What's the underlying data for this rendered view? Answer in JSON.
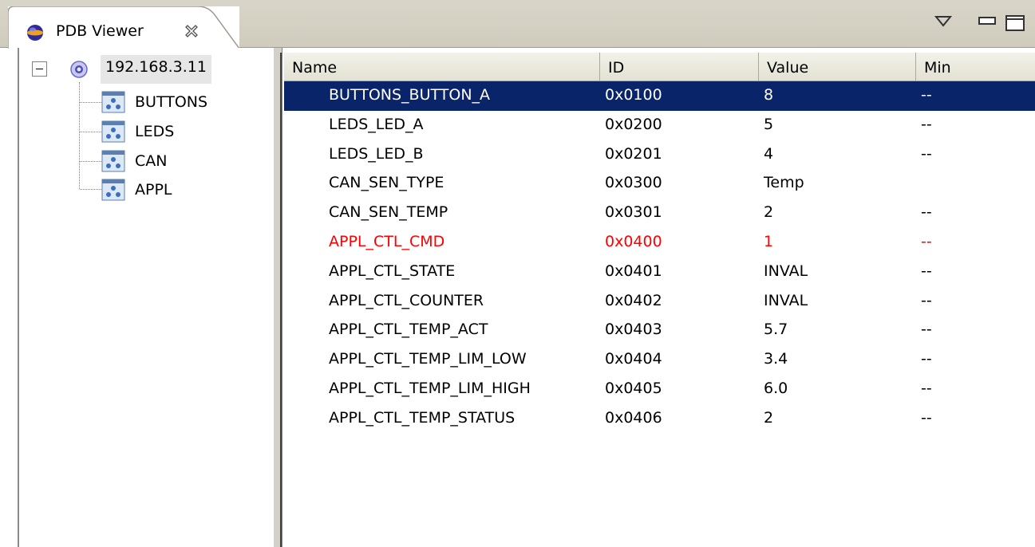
{
  "view_tab": {
    "title": "PDB Viewer",
    "icon": "globe-icon",
    "close_icon": "close-icon"
  },
  "view_toolbar": {
    "view_menu_icon": "view-menu-icon",
    "minimize_icon": "minimize-icon",
    "maximize_icon": "maximize-icon"
  },
  "tree": {
    "root": {
      "label": "192.168.3.11",
      "expanded": true,
      "icon": "server-icon"
    },
    "children": [
      {
        "label": "BUTTONS",
        "icon": "group-icon"
      },
      {
        "label": "LEDS",
        "icon": "group-icon"
      },
      {
        "label": "CAN",
        "icon": "group-icon"
      },
      {
        "label": "APPL",
        "icon": "group-icon"
      }
    ]
  },
  "table": {
    "columns": [
      "Name",
      "ID",
      "Value",
      "Min"
    ],
    "rows": [
      {
        "name": "BUTTONS_BUTTON_A",
        "id": "0x0100",
        "value": "8",
        "min": "--"
      },
      {
        "name": "LEDS_LED_A",
        "id": "0x0200",
        "value": "5",
        "min": "--"
      },
      {
        "name": "LEDS_LED_B",
        "id": "0x0201",
        "value": "4",
        "min": "--"
      },
      {
        "name": "CAN_SEN_TYPE",
        "id": "0x0300",
        "value": "Temp",
        "min": ""
      },
      {
        "name": "CAN_SEN_TEMP",
        "id": "0x0301",
        "value": "2",
        "min": "--"
      },
      {
        "name": "APPL_CTL_CMD",
        "id": "0x0400",
        "value": "1",
        "min": "--"
      },
      {
        "name": "APPL_CTL_STATE",
        "id": "0x0401",
        "value": "INVAL",
        "min": "--"
      },
      {
        "name": "APPL_CTL_COUNTER",
        "id": "0x0402",
        "value": "INVAL",
        "min": "--"
      },
      {
        "name": "APPL_CTL_TEMP_ACT",
        "id": "0x0403",
        "value": "5.7",
        "min": "--"
      },
      {
        "name": "APPL_CTL_TEMP_LIM_LOW",
        "id": "0x0404",
        "value": "3.4",
        "min": "--"
      },
      {
        "name": "APPL_CTL_TEMP_LIM_HIGH",
        "id": "0x0405",
        "value": "6.0",
        "min": "--"
      },
      {
        "name": "APPL_CTL_TEMP_STATUS",
        "id": "0x0406",
        "value": "2",
        "min": "--"
      }
    ],
    "selected_row": "BUTTONS_BUTTON_A",
    "highlighted_row": "APPL_CTL_CMD"
  },
  "colors": {
    "selection": "#0a246a",
    "alert_text": "#ff0000",
    "titlebar": "#d4d0c8"
  }
}
